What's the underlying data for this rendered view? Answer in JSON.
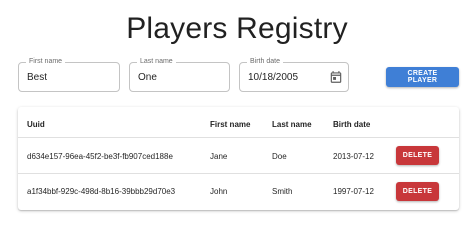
{
  "page": {
    "title": "Players Registry"
  },
  "form": {
    "first_name": {
      "label": "First name",
      "value": "Best"
    },
    "last_name": {
      "label": "Last name",
      "value": "One"
    },
    "birth_date": {
      "label": "Birth date",
      "value": "10/18/2005",
      "icon": "calendar-icon"
    },
    "create_label": "CREATE PLAYER",
    "create_color": "#3f7fd6"
  },
  "table": {
    "headers": {
      "uuid": "Uuid",
      "first_name": "First name",
      "last_name": "Last name",
      "birth_date": "Birth date"
    },
    "rows": [
      {
        "uuid": "d634e157-96ea-45f2-be3f-fb907ced188e",
        "first_name": "Jane",
        "last_name": "Doe",
        "birth_date": "2013-07-12",
        "action": "DELETE"
      },
      {
        "uuid": "a1f34bbf-929c-498d-8b16-39bbb29d70e3",
        "first_name": "John",
        "last_name": "Smith",
        "birth_date": "1997-07-12",
        "action": "DELETE"
      }
    ],
    "delete_color": "#c8373a"
  }
}
